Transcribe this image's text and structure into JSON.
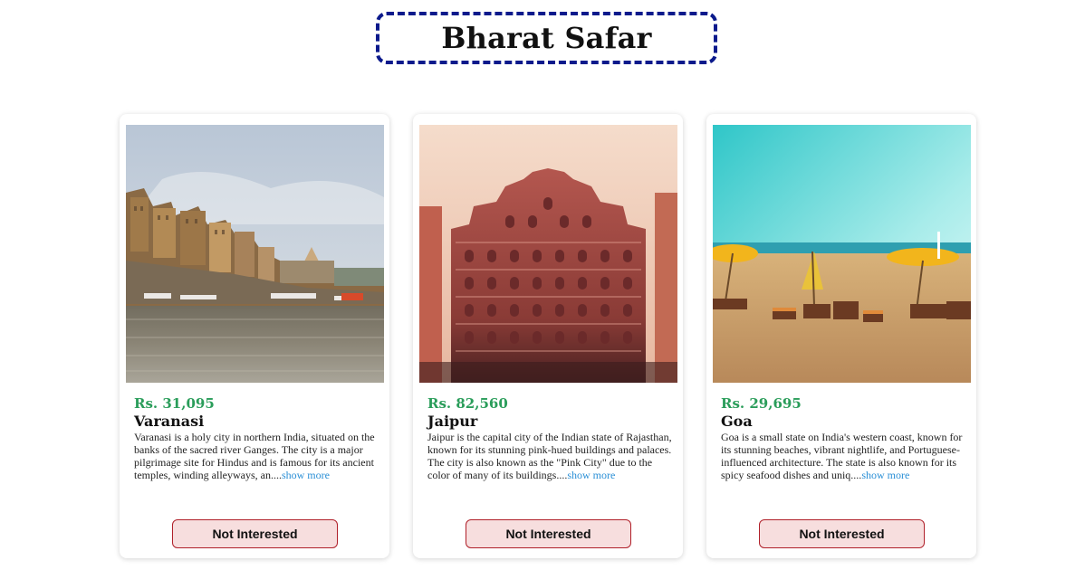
{
  "header": {
    "title": "Bharat Safar"
  },
  "cards": [
    {
      "image_icon": "varanasi-ghats-photo",
      "price": "Rs. 31,095",
      "city": "Varanasi",
      "description": "Varanasi is a holy city in northern India, situated on the banks of the sacred river Ganges. The city is a major pilgrimage site for Hindus and is famous for its ancient temples, winding alleyways, an....",
      "more_label": "show more",
      "button_label": "Not Interested"
    },
    {
      "image_icon": "jaipur-hawa-mahal-photo",
      "price": "Rs. 82,560",
      "city": "Jaipur",
      "description": "Jaipur is the capital city of the Indian state of Rajasthan, known for its stunning pink-hued buildings and palaces. The city is also known as the \"Pink City\" due to the color of many of its buildings....",
      "more_label": "show more",
      "button_label": "Not Interested"
    },
    {
      "image_icon": "goa-beach-photo",
      "price": "Rs. 29,695",
      "city": "Goa",
      "description": "Goa is a small state on India's western coast, known for its stunning beaches, vibrant nightlife, and Portuguese-influenced architecture. The state is also known for its spicy seafood dishes and uniq....",
      "more_label": "show more",
      "button_label": "Not Interested"
    }
  ],
  "colors": {
    "title_border": "#0b1a8c",
    "price": "#2a9d5a",
    "link": "#2a8fd6",
    "button_bg": "#f7dede",
    "button_border": "#b0202a"
  }
}
